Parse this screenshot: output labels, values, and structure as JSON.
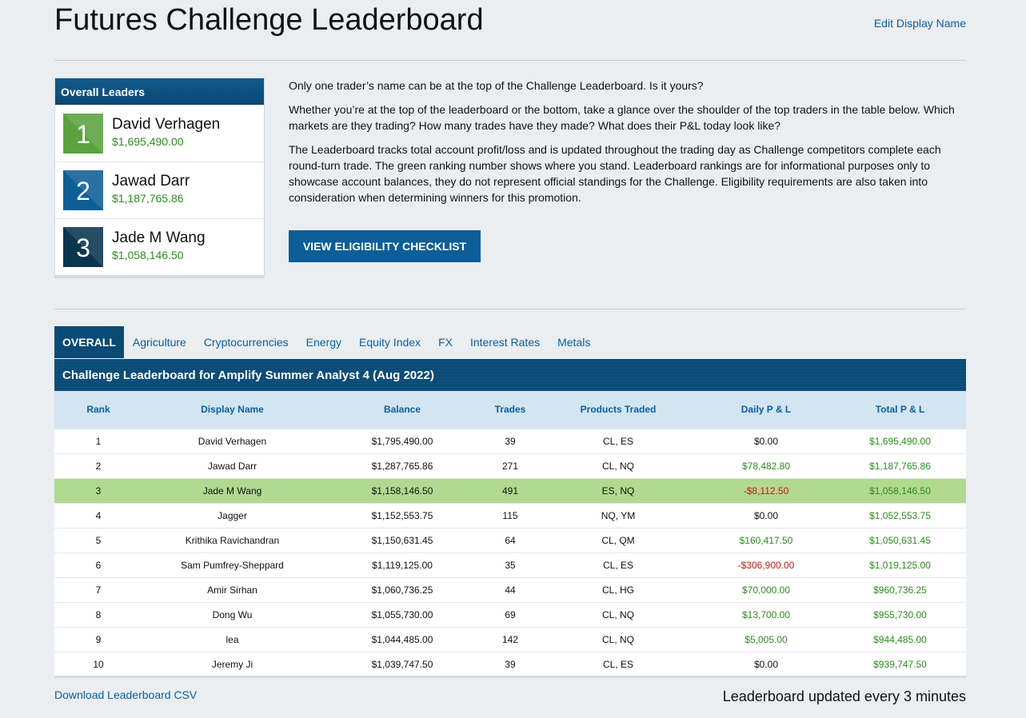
{
  "header": {
    "title": "Futures Challenge Leaderboard",
    "edit_link": "Edit Display Name"
  },
  "leaders": {
    "heading": "Overall Leaders",
    "items": [
      {
        "rank": "1",
        "name": "David Verhagen",
        "balance": "$1,695,490.00"
      },
      {
        "rank": "2",
        "name": "Jawad Darr",
        "balance": "$1,187,765.86"
      },
      {
        "rank": "3",
        "name": "Jade M Wang",
        "balance": "$1,058,146.50"
      }
    ]
  },
  "intro": {
    "p1": "Only one trader’s name can be at the top of the Challenge Leaderboard. Is it yours?",
    "p2": "Whether you’re at the top of the leaderboard or the bottom, take a glance over the shoulder of the top traders in the table below. Which markets are they trading? How many trades have they made? What does their P&L today look like?",
    "p3": "The Leaderboard tracks total account profit/loss and is updated throughout the trading day as Challenge competitors complete each round-turn trade. The green ranking number shows where you stand. Leaderboard rankings are for informational purposes only to showcase account balances, they do not represent official standings for the Challenge.  Eligibility requirements are also taken into consideration when determining winners for this promotion.",
    "button": "VIEW ELIGIBILITY CHECKLIST"
  },
  "tabs": [
    "OVERALL",
    "Agriculture",
    "Cryptocurrencies",
    "Energy",
    "Equity Index",
    "FX",
    "Interest Rates",
    "Metals"
  ],
  "table": {
    "title": "Challenge Leaderboard for Amplify Summer Analyst 4 (Aug 2022)",
    "columns": [
      "Rank",
      "Display Name",
      "Balance",
      "Trades",
      "Products Traded",
      "Daily P & L",
      "Total P & L"
    ],
    "rows": [
      [
        "1",
        "David Verhagen",
        "$1,795,490.00",
        "39",
        "CL, ES",
        "$0.00",
        "$1,695,490.00"
      ],
      [
        "2",
        "Jawad Darr",
        "$1,287,765.86",
        "271",
        "CL, NQ",
        "$78,482.80",
        "$1,187,765.86"
      ],
      [
        "3",
        "Jade M Wang",
        "$1,158,146.50",
        "491",
        "ES, NQ",
        "-$8,112.50",
        "$1,058,146.50"
      ],
      [
        "4",
        "Jagger",
        "$1,152,553.75",
        "115",
        "NQ, YM",
        "$0.00",
        "$1,052,553.75"
      ],
      [
        "5",
        "Krithika Ravichandran",
        "$1,150,631.45",
        "64",
        "CL, QM",
        "$160,417.50",
        "$1,050,631.45"
      ],
      [
        "6",
        "Sam Pumfrey-Sheppard",
        "$1,119,125.00",
        "35",
        "CL, ES",
        "-$306,900.00",
        "$1,019,125.00"
      ],
      [
        "7",
        "Amir Sirhan",
        "$1,060,736.25",
        "44",
        "CL, HG",
        "$70,000.00",
        "$960,736.25"
      ],
      [
        "8",
        "Dong Wu",
        "$1,055,730.00",
        "69",
        "CL, NQ",
        "$13,700.00",
        "$955,730.00"
      ],
      [
        "9",
        "lea",
        "$1,044,485.00",
        "142",
        "CL, NQ",
        "$5,005.00",
        "$944,485.00"
      ],
      [
        "10",
        "Jeremy Ji",
        "$1,039,747.50",
        "39",
        "CL, ES",
        "$0.00",
        "$939,747.50"
      ]
    ],
    "highlight_rank": "3"
  },
  "footer": {
    "csv_link": "Download Leaderboard CSV",
    "update_note": "Leaderboard updated every 3 minutes"
  },
  "colors": {
    "accent": "#0b5e98",
    "positive": "#2e8b1f",
    "negative": "#c01818",
    "highlight_row": "#b1d98f"
  }
}
